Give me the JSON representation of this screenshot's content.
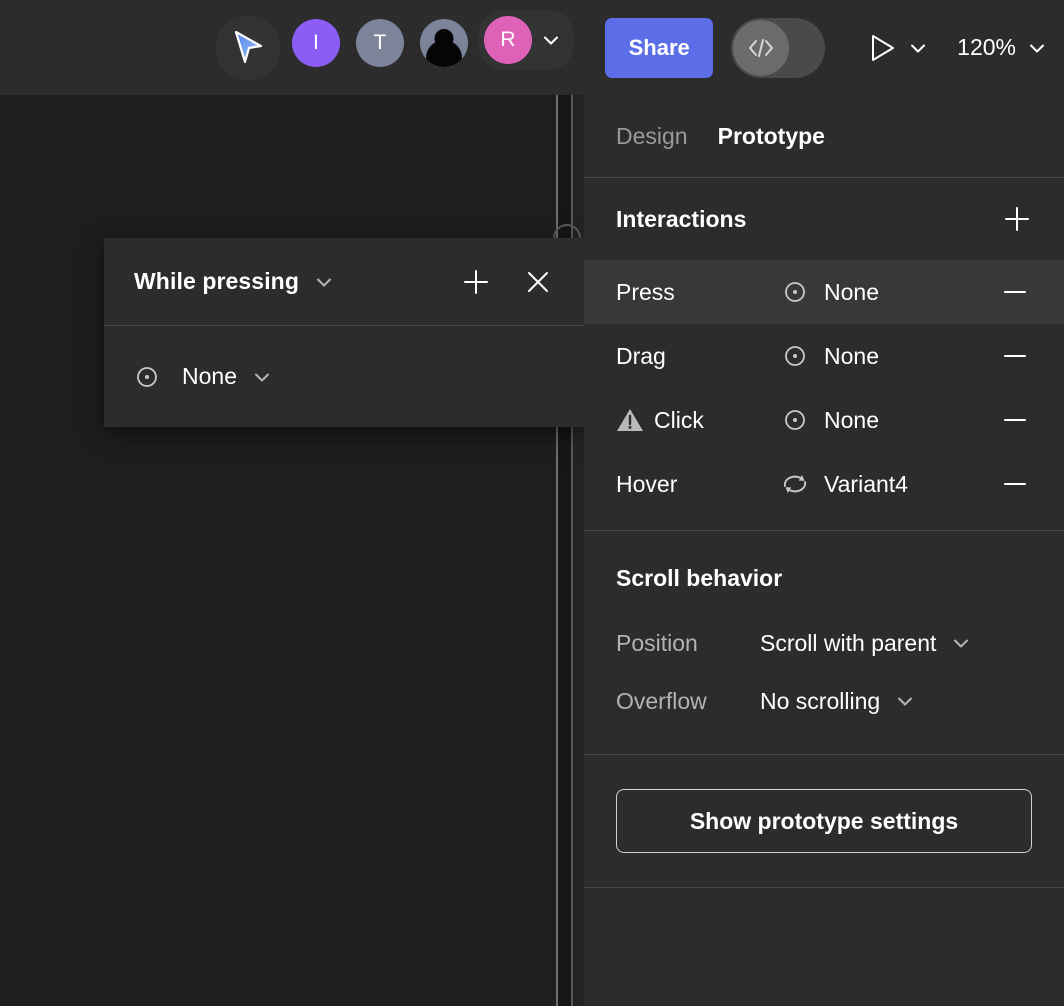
{
  "toolbar": {
    "cursor_icon": "multiplayer-cursor-icon",
    "avatars": [
      {
        "initial": "I",
        "color": "#8b5cf6",
        "type": "initial"
      },
      {
        "initial": "T",
        "color": "#7d8399",
        "type": "initial"
      },
      {
        "initial": "",
        "color": "#7d8399",
        "type": "person"
      },
      {
        "initial": "R",
        "color": "#e062b8",
        "type": "initial"
      }
    ],
    "avatar_chevron_icon": "chevron-down-icon",
    "share_label": "Share",
    "share_color": "#5b6ee8",
    "devmode_icon": "code-brackets-icon",
    "devmode_label": "</>",
    "play_icon": "play-icon",
    "play_chevron_icon": "chevron-down-icon",
    "zoom_level": "120%",
    "zoom_chevron_icon": "chevron-down-icon"
  },
  "canvas": {
    "background": "#1e1e1e"
  },
  "popup": {
    "title": "While pressing",
    "title_chevron_icon": "chevron-down-icon",
    "add_icon": "plus-icon",
    "close_icon": "close-icon",
    "target_icon": "target-icon",
    "value": "None",
    "value_chevron_icon": "chevron-down-icon"
  },
  "right_panel": {
    "tabs": [
      {
        "label": "Design",
        "active": false
      },
      {
        "label": "Prototype",
        "active": true
      }
    ],
    "interactions": {
      "title": "Interactions",
      "add_icon": "plus-icon",
      "rows": [
        {
          "trigger": "Press",
          "warning": false,
          "action_icon": "target-icon",
          "destination": "None",
          "remove_icon": "minus-icon",
          "selected": true
        },
        {
          "trigger": "Drag",
          "warning": false,
          "action_icon": "target-icon",
          "destination": "None",
          "remove_icon": "minus-icon",
          "selected": false
        },
        {
          "trigger": "Click",
          "warning": true,
          "action_icon": "target-icon",
          "destination": "None",
          "remove_icon": "minus-icon",
          "selected": false
        },
        {
          "trigger": "Hover",
          "warning": false,
          "action_icon": "swap-icon",
          "destination": "Variant4",
          "remove_icon": "minus-icon",
          "selected": false
        }
      ]
    },
    "scroll_behavior": {
      "title": "Scroll behavior",
      "position_label": "Position",
      "position_value": "Scroll with parent",
      "position_chevron_icon": "chevron-down-icon",
      "overflow_label": "Overflow",
      "overflow_value": "No scrolling",
      "overflow_chevron_icon": "chevron-down-icon"
    },
    "prototype_settings_button": "Show prototype settings"
  },
  "colors": {
    "panel_bg": "#2c2c2c",
    "canvas_bg": "#1e1e1e",
    "row_selected": "#383838",
    "divider": "#444444",
    "accent_blue": "#5b6ee8"
  }
}
